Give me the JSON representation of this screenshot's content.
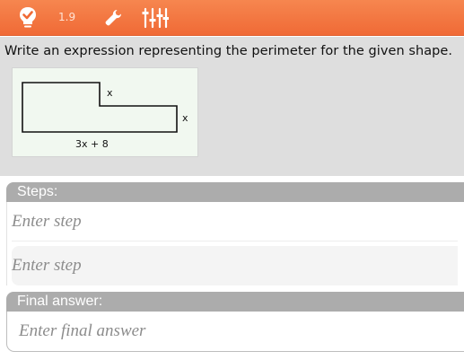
{
  "toolbar": {
    "version": "1.9",
    "icons": [
      "lightbulb-check-icon",
      "wrench-icon",
      "sliders-icon"
    ],
    "background": "#f06a36"
  },
  "problem": {
    "question": "Write an expression representing the perimeter for the given shape.",
    "figure": {
      "label_top_step": "x",
      "label_right": "x",
      "label_bottom": "3x + 8"
    }
  },
  "steps": {
    "header": "Steps:",
    "placeholders": [
      "Enter step",
      "Enter step"
    ]
  },
  "final_answer": {
    "header": "Final answer:",
    "placeholder": "Enter final answer"
  }
}
